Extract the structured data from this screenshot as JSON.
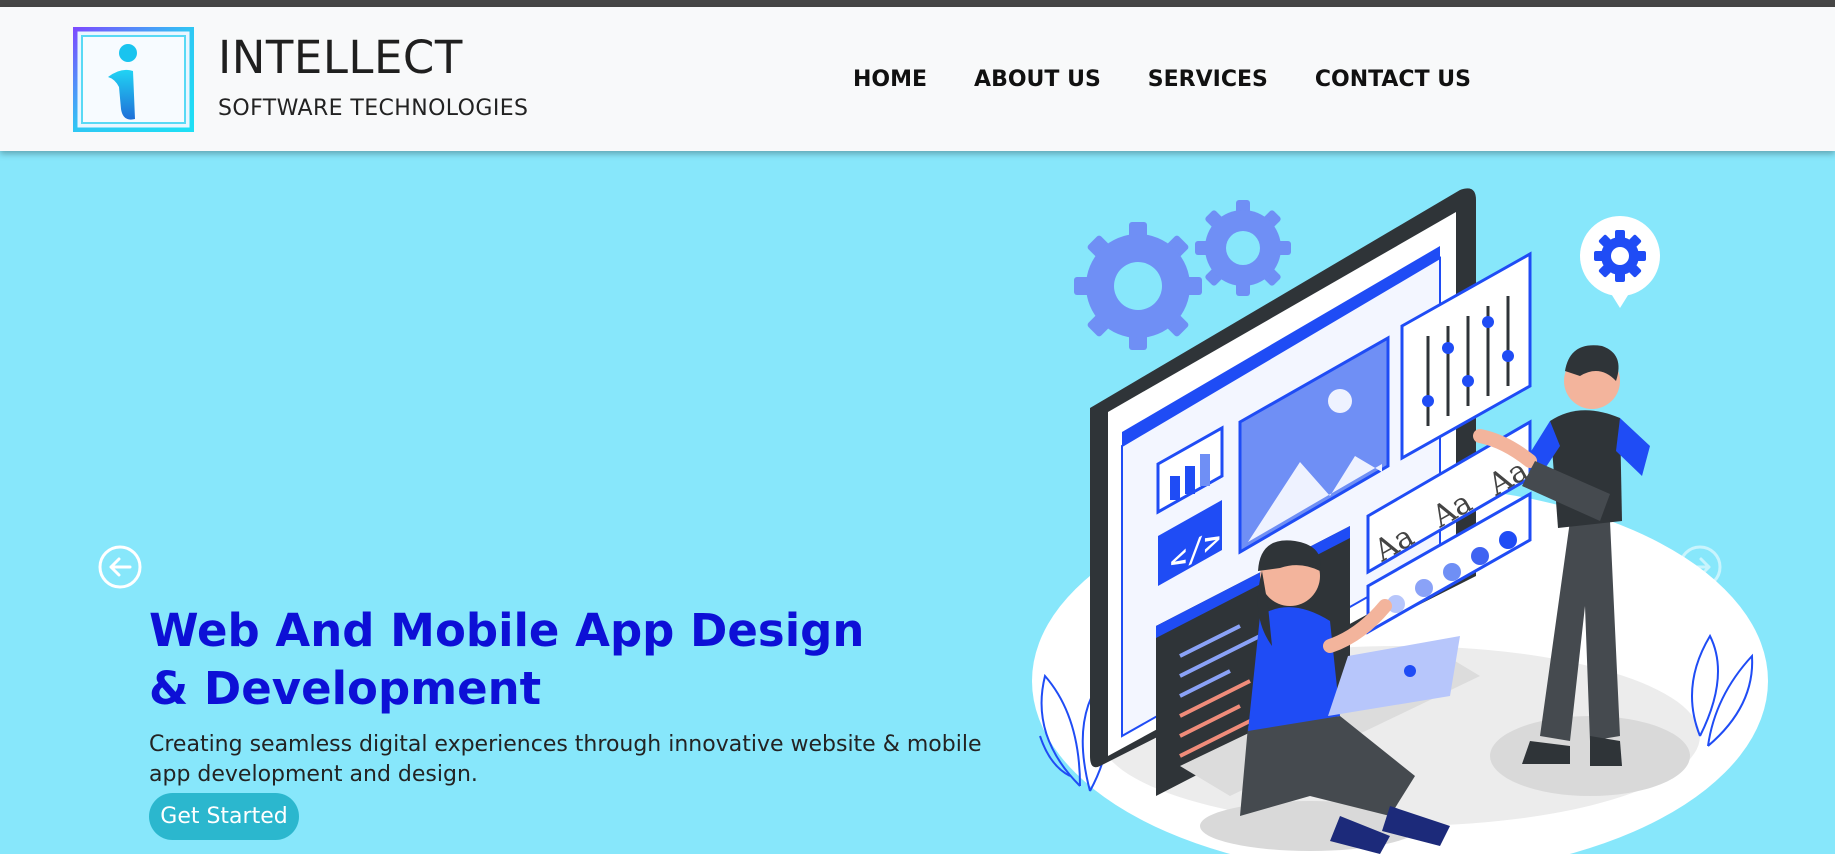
{
  "brand": {
    "name": "INTELLECT",
    "tagline": "SOFTWARE TECHNOLOGIES"
  },
  "nav": {
    "items": [
      {
        "label": "HOME"
      },
      {
        "label": "ABOUT US"
      },
      {
        "label": "SERVICES"
      },
      {
        "label": "CONTACT US"
      }
    ]
  },
  "hero": {
    "headline": "Web And Mobile App Design & Development",
    "description": "Creating seamless digital experiences through innovative website & mobile app development and design.",
    "cta_label": "Get Started",
    "illustration_text": {
      "font_sample_1": "Aa",
      "font_sample_2": "Aa",
      "font_sample_3": "Aa",
      "code_glyph": "</>"
    }
  },
  "carousel": {
    "prev_icon": "arrow-left-circle-icon",
    "next_icon": "arrow-right-circle-icon"
  },
  "colors": {
    "header_bg": "#f8f9fa",
    "hero_bg": "#87e7fb",
    "headline": "#0d10d6",
    "cta_bg": "#2bb7ce",
    "accent_blue": "#1f4cf5"
  }
}
